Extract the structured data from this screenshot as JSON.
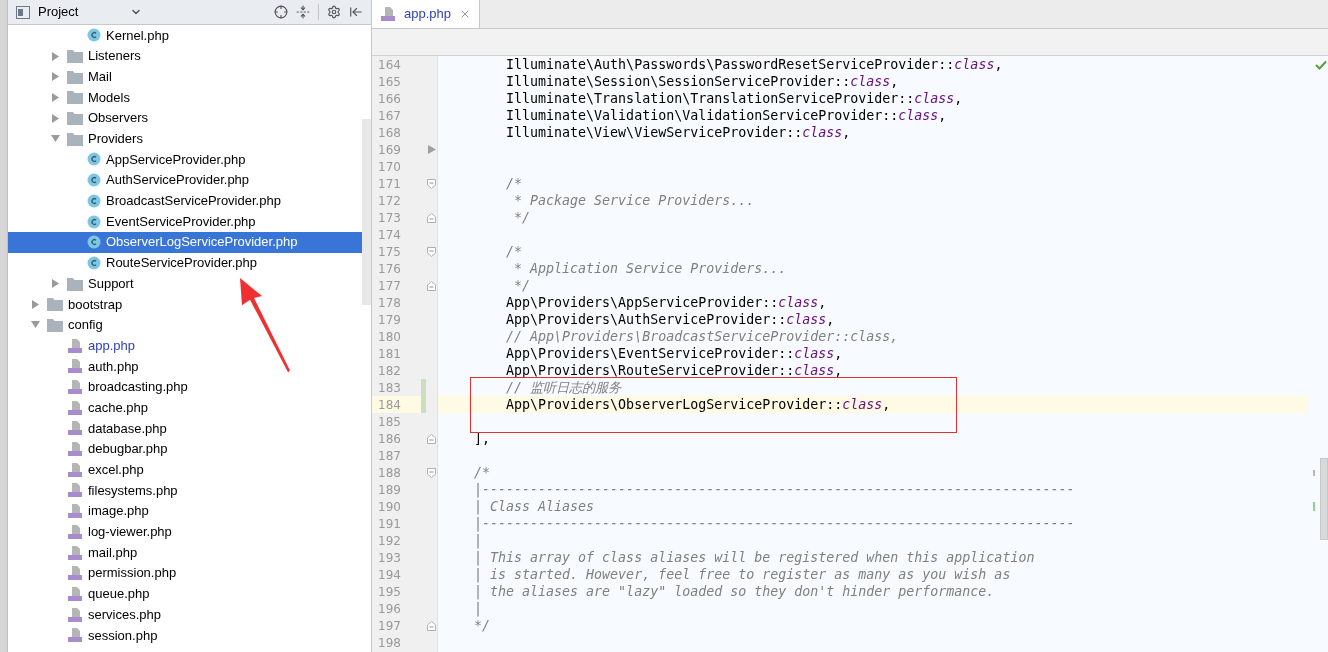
{
  "project_panel": {
    "title": "Project"
  },
  "tree": [
    {
      "children": [
        {
          "children": [
            {
              "name": "Kernel.php",
              "kind": "class",
              "selected": false,
              "modified": false
            }
          ]
        },
        {
          "name": "Listeners",
          "kind": "folder",
          "expanded": false,
          "selected": false
        },
        {
          "name": "Mail",
          "kind": "folder",
          "expanded": false,
          "selected": false
        },
        {
          "name": "Models",
          "kind": "folder",
          "expanded": false,
          "selected": false
        },
        {
          "name": "Observers",
          "kind": "folder",
          "expanded": false,
          "selected": false
        },
        {
          "name": "Providers",
          "kind": "folder",
          "expanded": true,
          "selected": false,
          "children": [
            {
              "name": "AppServiceProvider.php",
              "kind": "class",
              "selected": false,
              "modified": false
            },
            {
              "name": "AuthServiceProvider.php",
              "kind": "class",
              "selected": false,
              "modified": false
            },
            {
              "name": "BroadcastServiceProvider.php",
              "kind": "class",
              "selected": false,
              "modified": false
            },
            {
              "name": "EventServiceProvider.php",
              "kind": "class",
              "selected": false,
              "modified": false
            },
            {
              "name": "ObserverLogServiceProvider.php",
              "kind": "class",
              "selected": true,
              "modified": false
            },
            {
              "name": "RouteServiceProvider.php",
              "kind": "class",
              "selected": false,
              "modified": false
            }
          ]
        },
        {
          "name": "Support",
          "kind": "folder",
          "expanded": false,
          "selected": false
        }
      ]
    },
    {
      "name": "bootstrap",
      "kind": "folder",
      "expanded": false,
      "selected": false
    },
    {
      "name": "config",
      "kind": "folder",
      "expanded": true,
      "selected": false,
      "children": [
        {
          "name": "app.php",
          "kind": "php",
          "selected": false,
          "modified": true
        },
        {
          "name": "auth.php",
          "kind": "php",
          "selected": false,
          "modified": false
        },
        {
          "name": "broadcasting.php",
          "kind": "php",
          "selected": false,
          "modified": false
        },
        {
          "name": "cache.php",
          "kind": "php",
          "selected": false,
          "modified": false
        },
        {
          "name": "database.php",
          "kind": "php",
          "selected": false,
          "modified": false
        },
        {
          "name": "debugbar.php",
          "kind": "php",
          "selected": false,
          "modified": false
        },
        {
          "name": "excel.php",
          "kind": "php",
          "selected": false,
          "modified": false
        },
        {
          "name": "filesystems.php",
          "kind": "php",
          "selected": false,
          "modified": false
        },
        {
          "name": "image.php",
          "kind": "php",
          "selected": false,
          "modified": false
        },
        {
          "name": "log-viewer.php",
          "kind": "php",
          "selected": false,
          "modified": false
        },
        {
          "name": "mail.php",
          "kind": "php",
          "selected": false,
          "modified": false
        },
        {
          "name": "permission.php",
          "kind": "php",
          "selected": false,
          "modified": false
        },
        {
          "name": "queue.php",
          "kind": "php",
          "selected": false,
          "modified": false
        },
        {
          "name": "services.php",
          "kind": "php",
          "selected": false,
          "modified": false
        },
        {
          "name": "session.php",
          "kind": "php",
          "selected": false,
          "modified": false
        }
      ]
    }
  ],
  "editor_tabs": [
    {
      "label": "app.php",
      "selected": true
    }
  ],
  "code_lines": [
    {
      "number": "164",
      "changed": false,
      "current": false,
      "segments": [
        {
          "text": "        Illuminate\\Auth\\Passwords\\PasswordResetServiceProvider::",
          "kind": "plain"
        },
        {
          "text": "class",
          "kind": "keyword"
        },
        {
          "text": ",",
          "kind": "plain"
        }
      ]
    },
    {
      "number": "165",
      "changed": false,
      "current": false,
      "segments": [
        {
          "text": "        Illuminate\\Session\\SessionServiceProvider::",
          "kind": "plain"
        },
        {
          "text": "class",
          "kind": "keyword"
        },
        {
          "text": ",",
          "kind": "plain"
        }
      ]
    },
    {
      "number": "166",
      "changed": false,
      "current": false,
      "segments": [
        {
          "text": "        Illuminate\\Translation\\TranslationServiceProvider::",
          "kind": "plain"
        },
        {
          "text": "class",
          "kind": "keyword"
        },
        {
          "text": ",",
          "kind": "plain"
        }
      ]
    },
    {
      "number": "167",
      "changed": false,
      "current": false,
      "segments": [
        {
          "text": "        Illuminate\\Validation\\ValidationServiceProvider::",
          "kind": "plain"
        },
        {
          "text": "class",
          "kind": "keyword"
        },
        {
          "text": ",",
          "kind": "plain"
        }
      ]
    },
    {
      "number": "168",
      "changed": false,
      "current": false,
      "segments": [
        {
          "text": "        Illuminate\\View\\ViewServiceProvider::",
          "kind": "plain"
        },
        {
          "text": "class",
          "kind": "keyword"
        },
        {
          "text": ",",
          "kind": "plain"
        }
      ]
    },
    {
      "number": "169",
      "changed": false,
      "current": false,
      "gutter_mark": {
        "kind": "collapsed"
      }
    },
    {
      "number": "170",
      "changed": false,
      "current": false
    },
    {
      "number": "171",
      "changed": false,
      "current": false,
      "gutter_mark": {
        "kind": "fold_start"
      },
      "segments": [
        {
          "text": "        /*",
          "kind": "comment"
        }
      ]
    },
    {
      "number": "172",
      "changed": false,
      "current": false,
      "segments": [
        {
          "text": "         * Package Service Providers...",
          "kind": "comment"
        }
      ]
    },
    {
      "number": "173",
      "changed": false,
      "current": false,
      "gutter_mark": {
        "kind": "fold_end"
      },
      "segments": [
        {
          "text": "         */",
          "kind": "comment"
        }
      ]
    },
    {
      "number": "174",
      "changed": false,
      "current": false
    },
    {
      "number": "175",
      "changed": false,
      "current": false,
      "gutter_mark": {
        "kind": "fold_start"
      },
      "segments": [
        {
          "text": "        /*",
          "kind": "comment"
        }
      ]
    },
    {
      "number": "176",
      "changed": false,
      "current": false,
      "segments": [
        {
          "text": "         * Application Service Providers...",
          "kind": "comment"
        }
      ]
    },
    {
      "number": "177",
      "changed": false,
      "current": false,
      "gutter_mark": {
        "kind": "fold_end"
      },
      "segments": [
        {
          "text": "         */",
          "kind": "comment"
        }
      ]
    },
    {
      "number": "178",
      "changed": false,
      "current": false,
      "segments": [
        {
          "text": "        App\\Providers\\AppServiceProvider::",
          "kind": "plain"
        },
        {
          "text": "class",
          "kind": "keyword"
        },
        {
          "text": ",",
          "kind": "plain"
        }
      ]
    },
    {
      "number": "179",
      "changed": false,
      "current": false,
      "segments": [
        {
          "text": "        App\\Providers\\AuthServiceProvider::",
          "kind": "plain"
        },
        {
          "text": "class",
          "kind": "keyword"
        },
        {
          "text": ",",
          "kind": "plain"
        }
      ]
    },
    {
      "number": "180",
      "changed": false,
      "current": false,
      "segments": [
        {
          "text": "        // App\\Providers\\BroadcastServiceProvider::class,",
          "kind": "comment"
        }
      ]
    },
    {
      "number": "181",
      "changed": false,
      "current": false,
      "segments": [
        {
          "text": "        App\\Providers\\EventServiceProvider::",
          "kind": "plain"
        },
        {
          "text": "class",
          "kind": "keyword"
        },
        {
          "text": ",",
          "kind": "plain"
        }
      ]
    },
    {
      "number": "182",
      "changed": false,
      "current": false,
      "segments": [
        {
          "text": "        App\\Providers\\RouteServiceProvider::",
          "kind": "plain"
        },
        {
          "text": "class",
          "kind": "keyword"
        },
        {
          "text": ",",
          "kind": "plain"
        }
      ]
    },
    {
      "number": "183",
      "changed": true,
      "current": false,
      "segments": [
        {
          "text": "        // 监听日志的服务",
          "kind": "comment"
        }
      ]
    },
    {
      "number": "184",
      "changed": true,
      "current": true,
      "segments": [
        {
          "text": "        App\\Providers\\ObserverLogServiceProvider::",
          "kind": "plain"
        },
        {
          "text": "class",
          "kind": "keyword"
        },
        {
          "text": ",",
          "kind": "plain"
        }
      ]
    },
    {
      "number": "185",
      "changed": false,
      "current": false
    },
    {
      "number": "186",
      "changed": false,
      "current": false,
      "gutter_mark": {
        "kind": "fold_end"
      },
      "segments": [
        {
          "text": "    ],",
          "kind": "plain"
        }
      ]
    },
    {
      "number": "187",
      "changed": false,
      "current": false
    },
    {
      "number": "188",
      "changed": false,
      "current": false,
      "gutter_mark": {
        "kind": "fold_start"
      },
      "segments": [
        {
          "text": "    /*",
          "kind": "comment"
        }
      ]
    },
    {
      "number": "189",
      "changed": false,
      "current": false,
      "segments": [
        {
          "text": "    |--------------------------------------------------------------------------",
          "kind": "comment"
        }
      ]
    },
    {
      "number": "190",
      "changed": false,
      "current": false,
      "segments": [
        {
          "text": "    | Class Aliases",
          "kind": "comment"
        }
      ]
    },
    {
      "number": "191",
      "changed": false,
      "current": false,
      "segments": [
        {
          "text": "    |--------------------------------------------------------------------------",
          "kind": "comment"
        }
      ]
    },
    {
      "number": "192",
      "changed": false,
      "current": false,
      "segments": [
        {
          "text": "    |",
          "kind": "comment"
        }
      ]
    },
    {
      "number": "193",
      "changed": false,
      "current": false,
      "segments": [
        {
          "text": "    | This array of class aliases will be registered when this application",
          "kind": "comment"
        }
      ]
    },
    {
      "number": "194",
      "changed": false,
      "current": false,
      "segments": [
        {
          "text": "    | is started. However, feel free to register as many as you wish as",
          "kind": "comment"
        }
      ]
    },
    {
      "number": "195",
      "changed": false,
      "current": false,
      "segments": [
        {
          "text": "    | the aliases are \"lazy\" loaded so they don't hinder performance.",
          "kind": "comment"
        }
      ]
    },
    {
      "number": "196",
      "changed": false,
      "current": false,
      "segments": [
        {
          "text": "    |",
          "kind": "comment"
        }
      ]
    },
    {
      "number": "197",
      "changed": false,
      "current": false,
      "gutter_mark": {
        "kind": "fold_end"
      },
      "segments": [
        {
          "text": "    */",
          "kind": "comment"
        }
      ]
    },
    {
      "number": "198",
      "changed": false,
      "current": false
    }
  ]
}
